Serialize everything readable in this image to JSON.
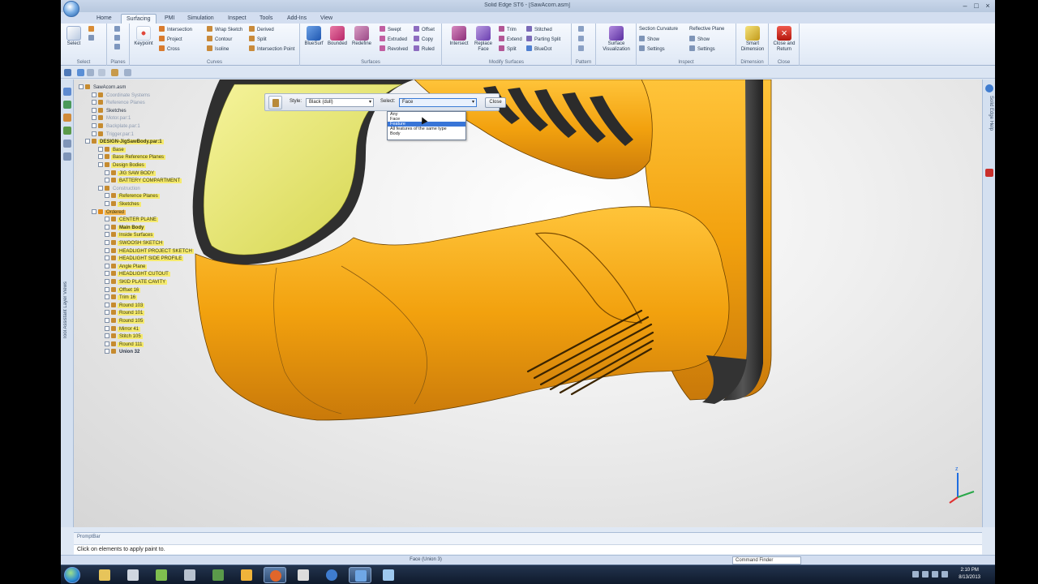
{
  "window": {
    "title": "Solid Edge ST6 - [SawAcorn.asm]"
  },
  "tabs": [
    "Home",
    "Surfacing",
    "PMI",
    "Simulation",
    "Inspect",
    "Tools",
    "Add-Ins",
    "View"
  ],
  "ribbon": {
    "select": {
      "label": "Select",
      "group": "Select"
    },
    "planes": {
      "group": "Planes"
    },
    "keypoint": "Keypoint",
    "curves": {
      "group": "Curves",
      "items": [
        "Intersection",
        "Project",
        "Cross",
        "Wrap Sketch",
        "Contour",
        "Isoline",
        "Derived",
        "Split",
        "Intersection Point"
      ]
    },
    "surfaces": {
      "group": "Surfaces",
      "big": [
        "BlueSurf",
        "Bounded",
        "Redefine"
      ],
      "items": [
        "Swept",
        "Extruded",
        "Revolved",
        "Offset",
        "Copy",
        "Ruled"
      ]
    },
    "modify": {
      "group": "Modify Surfaces",
      "big": [
        "Intersect",
        "Replace Face"
      ],
      "items": [
        "Trim",
        "Extend",
        "Split",
        "Stitched",
        "Parting Split",
        "BlueDot"
      ]
    },
    "pattern": {
      "group": "Pattern"
    },
    "viz": {
      "label": "Surface Visualization"
    },
    "inspect": {
      "group": "Inspect",
      "items": [
        "Section Curvature",
        "Show",
        "Settings",
        "Reflective Plane",
        "Show",
        "Settings"
      ]
    },
    "dimension": {
      "label": "Smart Dimension",
      "group": "Dimension"
    },
    "close": {
      "label": "Close and Return",
      "group": "Close"
    }
  },
  "tree": {
    "items": [
      {
        "label": "SawAcorn.asm",
        "indent": 0,
        "style": "plain"
      },
      {
        "label": "Coordinate Systems",
        "indent": 2,
        "style": "dim"
      },
      {
        "label": "Reference Planes",
        "indent": 2,
        "style": "dim"
      },
      {
        "label": "Sketches",
        "indent": 2,
        "style": "plain"
      },
      {
        "label": "Motor.par:1",
        "indent": 2,
        "style": "dim"
      },
      {
        "label": "Backplate.par:1",
        "indent": 2,
        "style": "dim"
      },
      {
        "label": "Trigger.par:1",
        "indent": 2,
        "style": "dim"
      },
      {
        "label": "DESIGN-JigSawBody.par:1",
        "indent": 1,
        "style": "hl-bold"
      },
      {
        "label": "Base",
        "indent": 3,
        "style": "hl"
      },
      {
        "label": "Base Reference Planes",
        "indent": 3,
        "style": "hl"
      },
      {
        "label": "Design Bodies",
        "indent": 3,
        "style": "hl"
      },
      {
        "label": "JIG SAW BODY",
        "indent": 4,
        "style": "hl"
      },
      {
        "label": "BATTERY COMPARTMENT",
        "indent": 4,
        "style": "hl"
      },
      {
        "label": "Construction",
        "indent": 3,
        "style": "dim"
      },
      {
        "label": "Reference Planes",
        "indent": 4,
        "style": "hl"
      },
      {
        "label": "Sketches",
        "indent": 4,
        "style": "hl"
      },
      {
        "label": "Ordered",
        "indent": 2,
        "style": "hl-orange"
      },
      {
        "label": "CENTER PLANE",
        "indent": 4,
        "style": "hl"
      },
      {
        "label": "Main Body",
        "indent": 4,
        "style": "hl-bold"
      },
      {
        "label": "Inside Surfaces",
        "indent": 4,
        "style": "hl"
      },
      {
        "label": "SWOOSH SKETCH",
        "indent": 4,
        "style": "hl"
      },
      {
        "label": "HEADLIGHT PROJECT SKETCH",
        "indent": 4,
        "style": "hl"
      },
      {
        "label": "HEADLIGHT SIDE PROFILE",
        "indent": 4,
        "style": "hl"
      },
      {
        "label": "Angle Plane",
        "indent": 4,
        "style": "hl"
      },
      {
        "label": "HEADLIGHT CUTOUT",
        "indent": 4,
        "style": "hl"
      },
      {
        "label": "SKID PLATE CAVITY",
        "indent": 4,
        "style": "hl"
      },
      {
        "label": "Offset 16",
        "indent": 4,
        "style": "hl"
      },
      {
        "label": "Trim 16",
        "indent": 4,
        "style": "hl"
      },
      {
        "label": "Round 103",
        "indent": 4,
        "style": "hl"
      },
      {
        "label": "Round 101",
        "indent": 4,
        "style": "hl"
      },
      {
        "label": "Round 105",
        "indent": 4,
        "style": "hl"
      },
      {
        "label": "Mirror 41",
        "indent": 4,
        "style": "hl"
      },
      {
        "label": "Stitch 105",
        "indent": 4,
        "style": "hl"
      },
      {
        "label": "Round 111",
        "indent": 4,
        "style": "hl"
      },
      {
        "label": "Union 32",
        "indent": 4,
        "style": "plain-bold"
      }
    ]
  },
  "paint": {
    "style_label": "Style:",
    "style_value": "Black (dull)",
    "select_label": "Select:",
    "select_value": "Face",
    "close_label": "Close",
    "select_options": [
      "Any",
      "Face",
      "Feature",
      "All features of the same type",
      "Body"
    ],
    "selected_option_index": 2
  },
  "right_panel": {
    "tab_label": "Solid Edge Help"
  },
  "left_panel": {
    "tab_label": "Tool Assistant Layer Views"
  },
  "prompt": {
    "title": "PromptBar",
    "text": "Click on elements to apply paint to."
  },
  "status": {
    "center": "Face (Union 3)",
    "command_finder": "Command Finder"
  },
  "taskbar": {
    "time": "2:10 PM",
    "date": "8/13/2013"
  },
  "colors": {
    "accent": "#ffb000",
    "body": "#f2a10e",
    "rubber": "#3a3a3a",
    "grip": "#e7e86a",
    "ribbon": "#dfe8f4"
  }
}
